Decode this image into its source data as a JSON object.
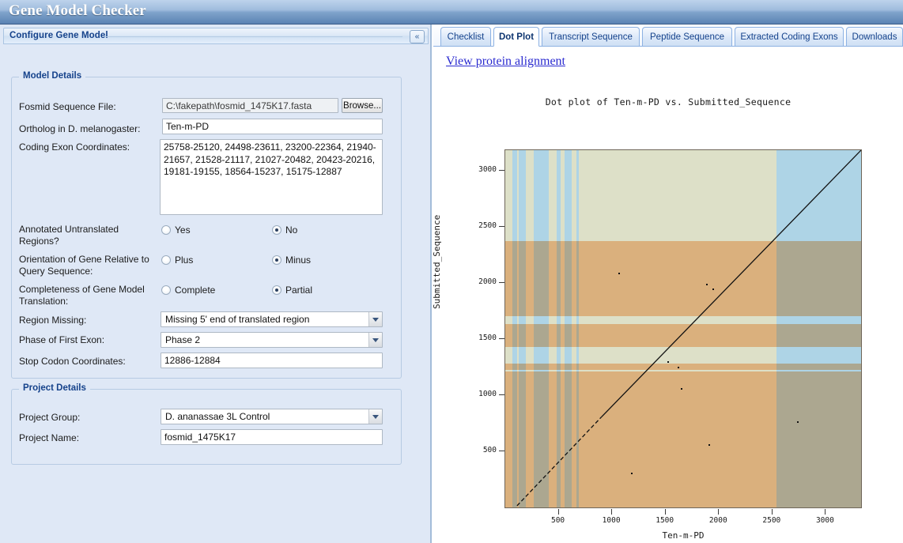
{
  "window": {
    "title": "Gene Model Checker"
  },
  "left_panel": {
    "header": "Configure Gene Model",
    "collapse_icon": "double-chevron-left-icon",
    "collapse_glyph": "«",
    "model_details": {
      "legend": "Model Details",
      "fields": {
        "fosmid_label": "Fosmid Sequence File:",
        "fosmid_value": "C:\\fakepath\\fosmid_1475K17.fasta",
        "browse_label": "Browse...",
        "ortholog_label": "Ortholog in D. melanogaster:",
        "ortholog_value": "Ten-m-PD",
        "exons_label": "Coding Exon Coordinates:",
        "exons_value": "25758-25120, 24498-23611, 23200-22364, 21940-21657, 21528-21117, 21027-20482, 20423-20216, 19181-19155, 18564-15237, 15175-12887",
        "utr_label": "Annotated Untranslated Regions?",
        "utr_yes": "Yes",
        "utr_no": "No",
        "utr_selected": "No",
        "orientation_label": "Orientation of Gene Relative to Query Sequence:",
        "orientation_plus": "Plus",
        "orientation_minus": "Minus",
        "orientation_selected": "Minus",
        "completeness_label": "Completeness of Gene Model Translation:",
        "completeness_complete": "Complete",
        "completeness_partial": "Partial",
        "completeness_selected": "Partial",
        "region_missing_label": "Region Missing:",
        "region_missing_value": "Missing 5' end of translated region",
        "phase_label": "Phase of First Exon:",
        "phase_value": "Phase 2",
        "stop_codon_label": "Stop Codon Coordinates:",
        "stop_codon_value": "12886-12884"
      }
    },
    "project_details": {
      "legend": "Project Details",
      "group_label": "Project Group:",
      "group_value": "D. ananassae 3L Control",
      "name_label": "Project Name:",
      "name_value": "fosmid_1475K17"
    }
  },
  "right_panel": {
    "tabs": [
      {
        "label": "Checklist",
        "active": false
      },
      {
        "label": "Dot Plot",
        "active": true
      },
      {
        "label": "Transcript Sequence",
        "active": false
      },
      {
        "label": "Peptide Sequence",
        "active": false
      },
      {
        "label": "Extracted Coding Exons",
        "active": false
      },
      {
        "label": "Downloads",
        "active": false
      }
    ],
    "protein_alignment_link": "View protein alignment"
  },
  "chart_data": {
    "type": "scatter",
    "title": "Dot plot of Ten-m-PD vs. Submitted_Sequence",
    "xlabel": "Ten-m-PD",
    "ylabel": "Submitted_Sequence",
    "xlim": [
      0,
      3330
    ],
    "ylim": [
      0,
      3180
    ],
    "xticks": [
      500,
      1000,
      1500,
      2000,
      2500,
      3000
    ],
    "yticks": [
      500,
      1000,
      1500,
      2000,
      2500,
      3000
    ],
    "grid": false,
    "legend": null,
    "colors": {
      "vertical_band": "#aed4e6",
      "background": "#dde0c8",
      "horizontal_band": "#fcc9a0",
      "overlap": "#d4bfbf",
      "point": "#111111",
      "plot_border": "#6f6659"
    },
    "vertical_bands": [
      [
        70,
        110
      ],
      [
        125,
        190
      ],
      [
        265,
        405
      ],
      [
        480,
        520
      ],
      [
        555,
        625
      ],
      [
        668,
        690
      ],
      [
        2540,
        3330
      ]
    ],
    "horizontal_bands": [
      [
        0,
        1210
      ],
      [
        1225,
        1280
      ],
      [
        1430,
        1630
      ],
      [
        1700,
        2370
      ]
    ],
    "diagonal": {
      "description": "main identity diagonal from origin-ish to top-right",
      "from": [
        110,
        15
      ],
      "to": [
        3330,
        3180
      ],
      "dashed_below": 900
    },
    "outliers": [
      [
        1060,
        2090
      ],
      [
        1880,
        1990
      ],
      [
        1940,
        1950
      ],
      [
        1520,
        1300
      ],
      [
        1610,
        1255
      ],
      [
        1640,
        1060
      ],
      [
        2730,
        770
      ],
      [
        1900,
        560
      ],
      [
        1180,
        310
      ]
    ]
  }
}
